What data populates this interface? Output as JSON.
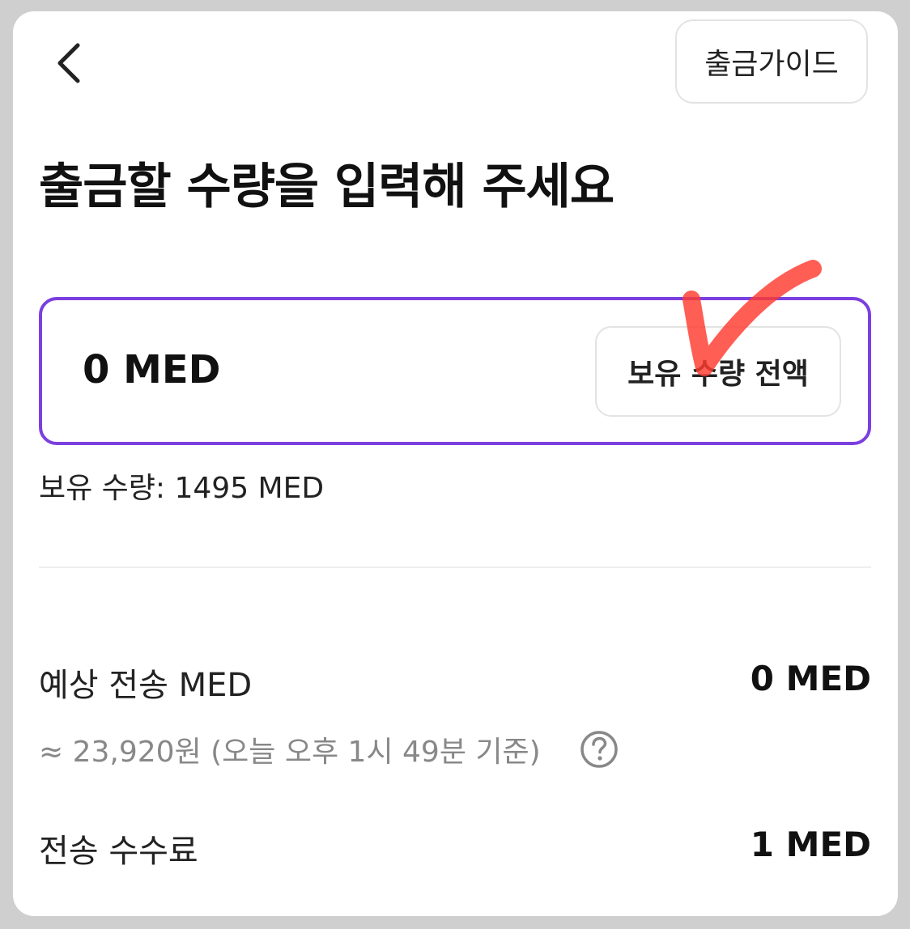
{
  "header": {
    "back_icon": "chevron-left-icon",
    "guide_label": "출금가이드"
  },
  "title": "출금할 수량을 입력해 주세요",
  "amount_input": {
    "value": "0 MED",
    "max_button_label": "보유 수량 전액",
    "accent_color": "#7b3fe0"
  },
  "annotation": {
    "mark": "check-mark-icon",
    "color": "#ff3b30"
  },
  "balance_text": "보유 수량: 1495 MED",
  "estimate": {
    "label": "예상 전송 MED",
    "value": "0 MED",
    "krw_text": "≈ 23,920원 (오늘 오후 1시 49분 기준)",
    "help_icon": "question-circle-icon"
  },
  "fee": {
    "label": "전송 수수료",
    "value": "1 MED"
  }
}
